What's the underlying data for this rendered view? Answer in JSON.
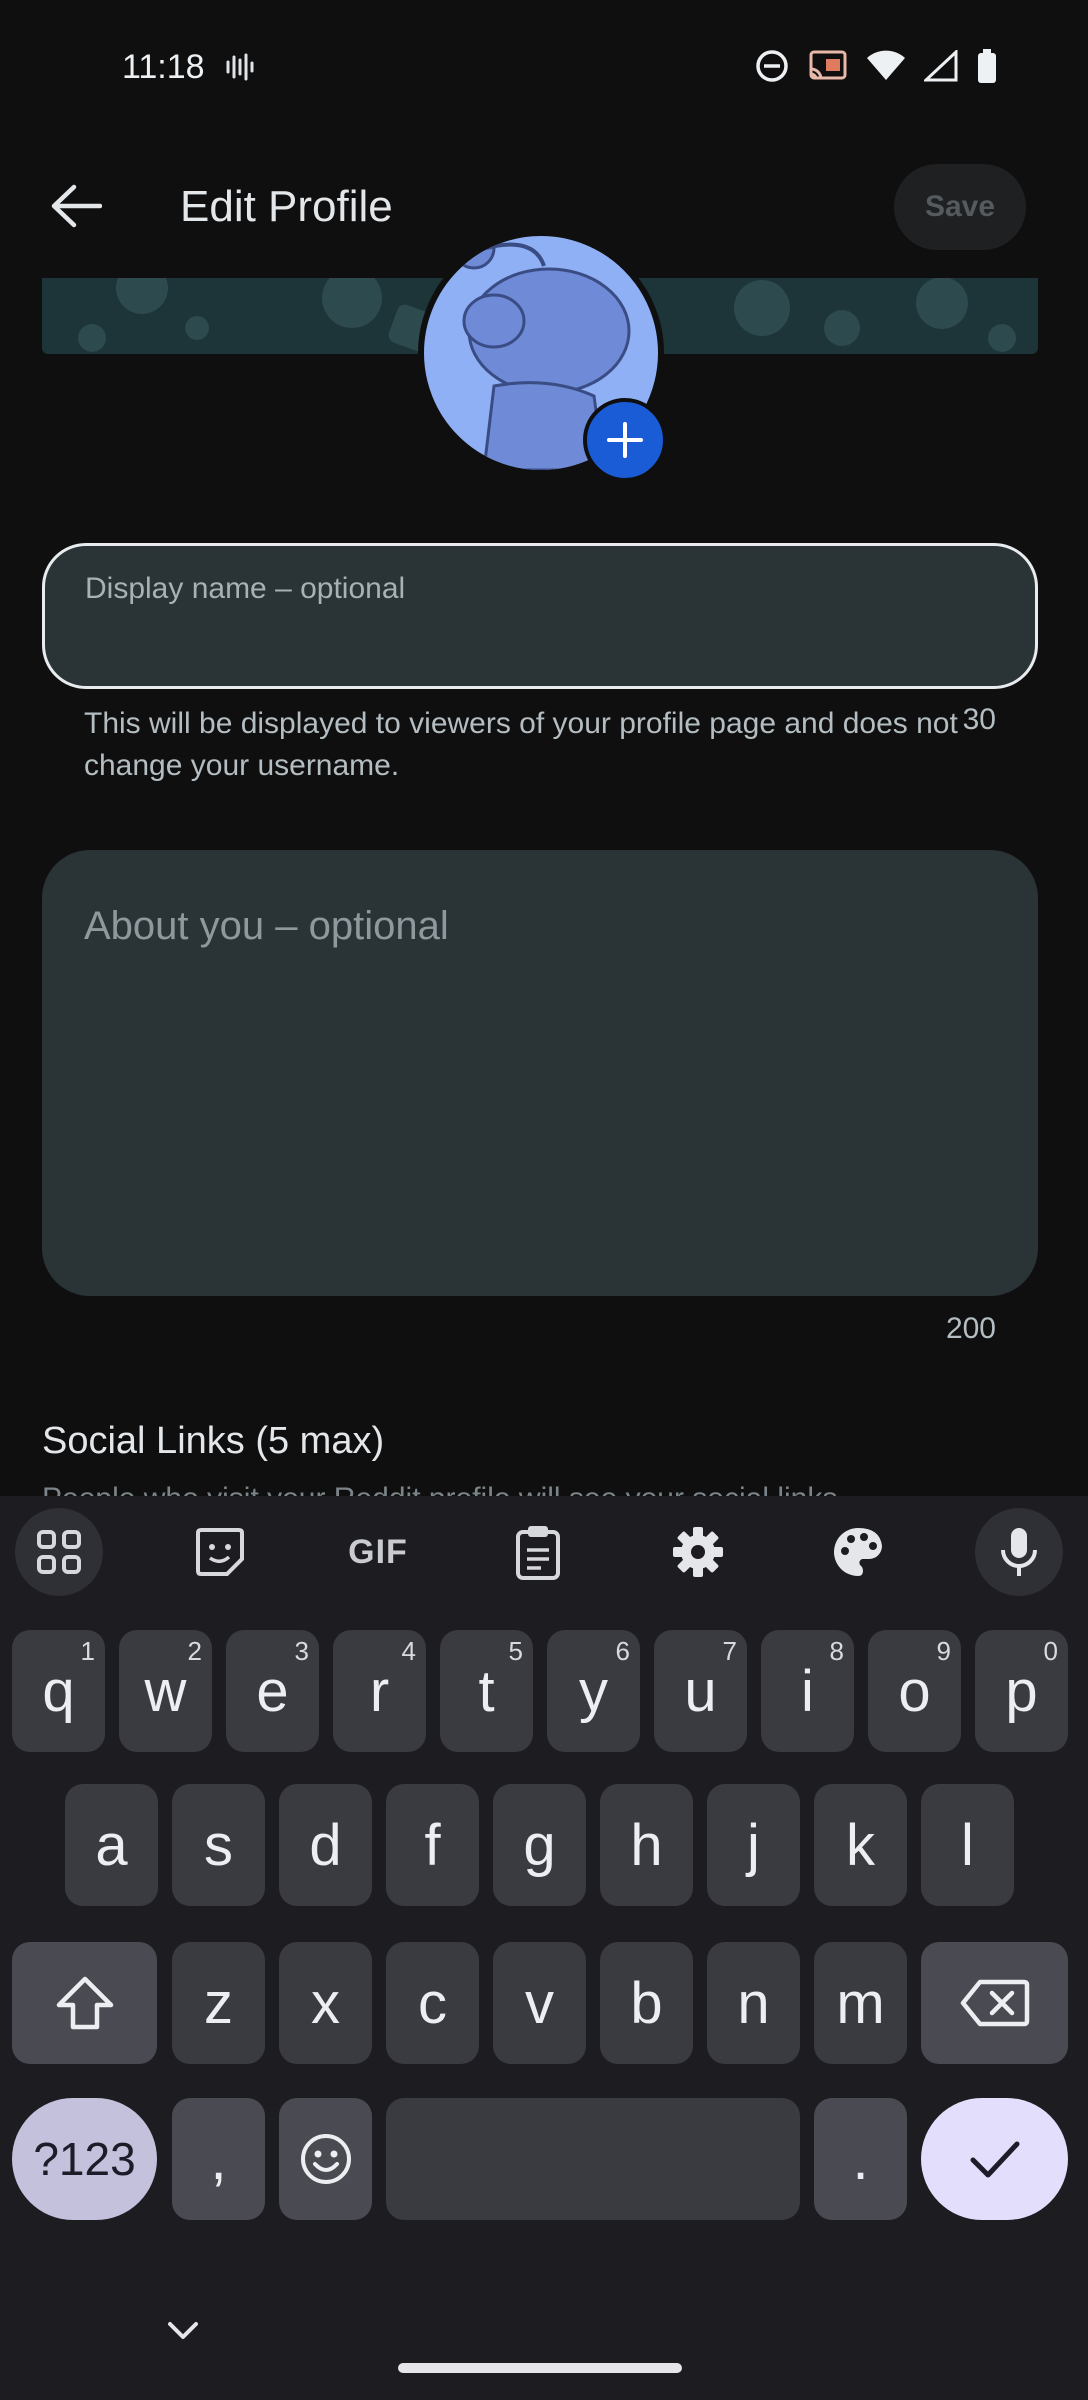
{
  "status_bar": {
    "time": "11:18"
  },
  "header": {
    "title": "Edit Profile",
    "save_label": "Save"
  },
  "profile": {
    "display_name_placeholder": "Display name – optional",
    "display_name_helper": "This will be displayed to viewers of your profile page and does not change your username.",
    "display_name_remaining": "30",
    "about_placeholder": "About you – optional",
    "about_remaining": "200",
    "social_links_title": "Social Links (5 max)",
    "social_links_subtitle": "People who visit your Reddit profile will see your social links."
  },
  "keyboard": {
    "toolbar": {
      "gif_label": "GIF"
    },
    "row1": [
      {
        "k": "q",
        "n": "1"
      },
      {
        "k": "w",
        "n": "2"
      },
      {
        "k": "e",
        "n": "3"
      },
      {
        "k": "r",
        "n": "4"
      },
      {
        "k": "t",
        "n": "5"
      },
      {
        "k": "y",
        "n": "6"
      },
      {
        "k": "u",
        "n": "7"
      },
      {
        "k": "i",
        "n": "8"
      },
      {
        "k": "o",
        "n": "9"
      },
      {
        "k": "p",
        "n": "0"
      }
    ],
    "row2": [
      "a",
      "s",
      "d",
      "f",
      "g",
      "h",
      "j",
      "k",
      "l"
    ],
    "row3": [
      "z",
      "x",
      "c",
      "v",
      "b",
      "n",
      "m"
    ],
    "symbols_label": "?123",
    "comma": ",",
    "period": "."
  }
}
